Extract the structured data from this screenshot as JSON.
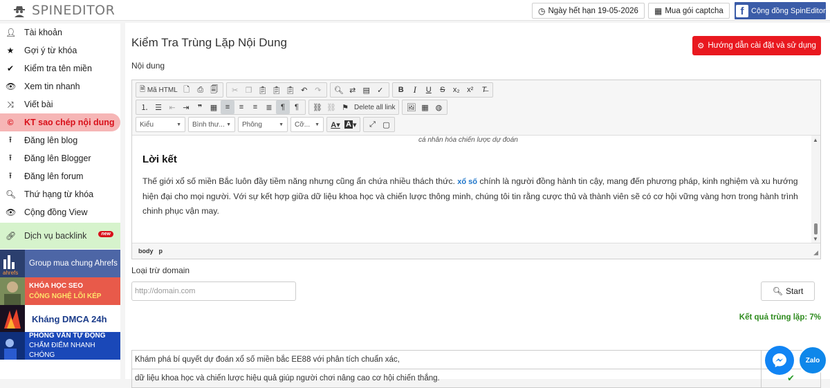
{
  "app": {
    "logo_text": "SPINEDITOR"
  },
  "header": {
    "expiry": "Ngày hết hạn 19-05-2026",
    "captcha": "Mua gói captcha",
    "community": "Cộng đồng SpinEditor"
  },
  "sidebar": {
    "items": [
      {
        "label": "Tài khoản",
        "icon": "user-icon"
      },
      {
        "label": "Gợi ý từ khóa",
        "icon": "star-icon"
      },
      {
        "label": "Kiểm tra tên miền",
        "icon": "check-icon"
      },
      {
        "label": "Xem tin nhanh",
        "icon": "eye-icon"
      },
      {
        "label": "Viết bài",
        "icon": "shuffle-icon"
      },
      {
        "label": "KT sao chép nội dung",
        "icon": "copyright-icon",
        "active": true
      },
      {
        "label": "Đăng lên blog",
        "icon": "upload-icon"
      },
      {
        "label": "Đăng lên Blogger",
        "icon": "upload-icon"
      },
      {
        "label": "Đăng lên forum",
        "icon": "upload-icon"
      },
      {
        "label": "Thứ hạng từ khóa",
        "icon": "search-icon"
      },
      {
        "label": "Cộng đồng View",
        "icon": "eye-icon"
      }
    ],
    "backlink": {
      "label": "Dịch vụ backlink",
      "badge": "new"
    },
    "banners": {
      "ahrefs_logo": "ahrefs",
      "ahrefs": "Group mua chung Ahrefs",
      "seo_line1": "KHÓA HỌC SEO",
      "seo_line2": "CÔNG NGHỆ LÕI KÉP",
      "dmca": "Kháng DMCA 24h",
      "interview_line1": "PHỎNG VẤN TỰ ĐỘNG",
      "interview_line2": "CHẤM ĐIỂM NHANH CHÓNG"
    }
  },
  "main": {
    "title": "Kiểm Tra Trùng Lặp Nội Dung",
    "guide_button": "Hướng dẫn cài đặt và sử dụng",
    "content_label": "Nội dung",
    "exclude_label": "Loại trừ domain",
    "domain_placeholder": "http://domain.com",
    "start_button": "Start",
    "result": "Kết quả trùng lặp: 7%"
  },
  "editor": {
    "toolbar": {
      "source": "Mã HTML",
      "delete_links": "Delete all link",
      "styles": "Kiểu",
      "format": "Bình thư...",
      "font": "Phông",
      "size": "Cỡ..."
    },
    "cut_text": "cá nhân hóa chiến lược dự đoán",
    "heading": "Lời kết",
    "para_before": "Thế giới xổ số miền Bắc luôn đầy tiềm năng nhưng cũng ẩn chứa nhiều thách thức.",
    "para_link": "xổ số",
    "para_after": "chính là người đồng hành tin cậy, mang đến phương pháp, kinh nghiệm và xu hướng hiện đại cho mọi người. Với sự kết hợp giữa dữ liệu khoa học và chiến lược thông minh, chúng tôi tin rằng cược thủ và thành viên sẽ có cơ hội vững vàng hơn trong hành trình chinh phục vận may.",
    "path": [
      "body",
      "p"
    ]
  },
  "results": [
    {
      "text": "Khám phá bí quyết dự đoán xổ số miền bắc EE88 với phân tích chuẩn xác,"
    },
    {
      "text": "dữ liệu khoa học và chiến lược hiệu quả giúp người chơi nâng cao cơ hội chiến thắng."
    }
  ],
  "floating": {
    "messenger": "messenger-icon",
    "zalo": "Zalo"
  },
  "colors": {
    "accent_red": "#e9181f",
    "active_bg": "#f6b6b6",
    "result_green": "#2e8b1e",
    "fb_blue": "#3b5ca8"
  }
}
